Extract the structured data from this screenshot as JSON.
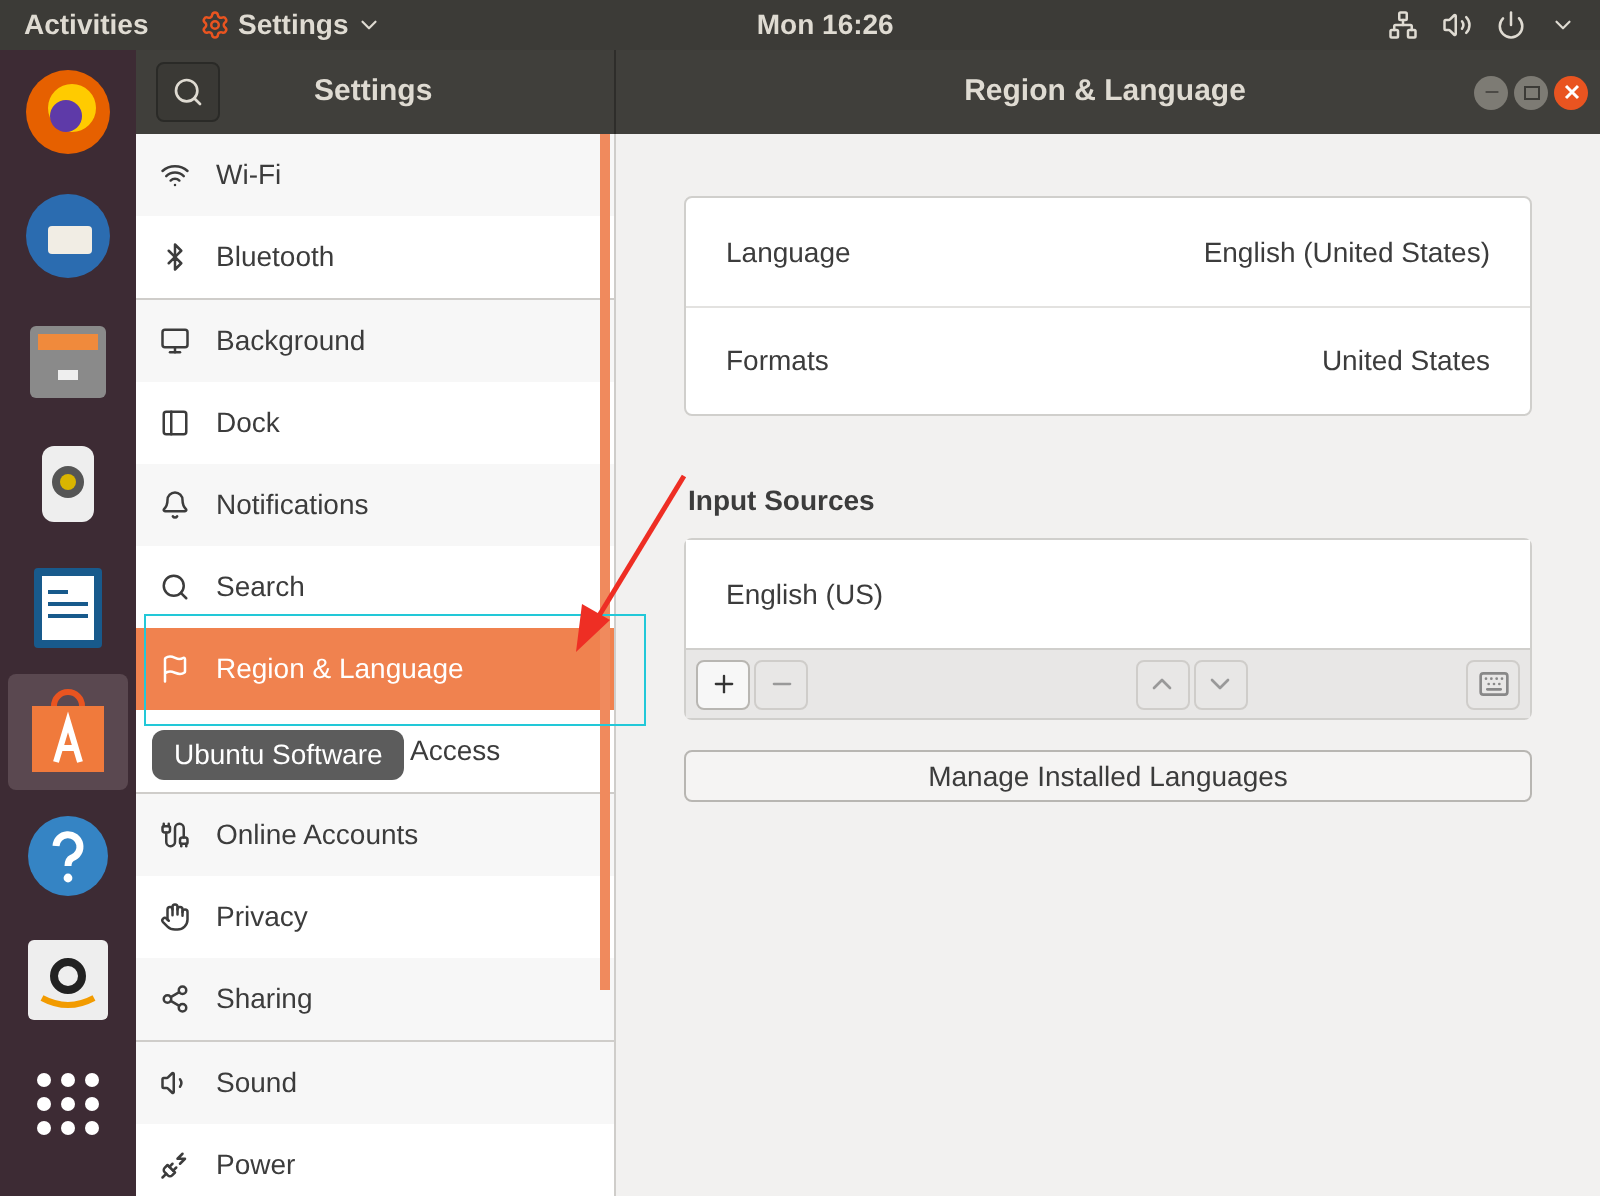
{
  "top_bar": {
    "activities": "Activities",
    "app_menu": "Settings",
    "clock": "Mon 16:26"
  },
  "dock": [
    {
      "selected": false
    },
    {
      "selected": false
    },
    {
      "selected": false
    },
    {
      "selected": false
    },
    {
      "selected": false
    },
    {
      "selected": true
    },
    {
      "selected": false
    },
    {
      "selected": false
    },
    {
      "selected": false
    }
  ],
  "tooltip": "Ubuntu Software",
  "header": {
    "sidebar_title": "Settings",
    "title": "Region & Language"
  },
  "sidebar": {
    "groups": [
      [
        {
          "label": "Wi-Fi",
          "selected": false
        },
        {
          "label": "Bluetooth",
          "selected": false
        }
      ],
      [
        {
          "label": "Background",
          "selected": false
        },
        {
          "label": "Dock",
          "selected": false
        },
        {
          "label": "Notifications",
          "selected": false
        },
        {
          "label": "Search",
          "selected": false
        },
        {
          "label": "Region & Language",
          "selected": true
        },
        {
          "label": "Access",
          "selected": false
        }
      ],
      [
        {
          "label": "Online Accounts",
          "selected": false
        },
        {
          "label": "Privacy",
          "selected": false
        },
        {
          "label": "Sharing",
          "selected": false
        }
      ],
      [
        {
          "label": "Sound",
          "selected": false
        },
        {
          "label": "Power",
          "selected": false
        }
      ]
    ]
  },
  "language_panel": [
    {
      "label": "Language",
      "value": "English (United States)"
    },
    {
      "label": "Formats",
      "value": "United States"
    }
  ],
  "input_sources": {
    "heading": "Input Sources",
    "items": [
      "English (US)"
    ]
  },
  "manage_button": "Manage Installed Languages"
}
